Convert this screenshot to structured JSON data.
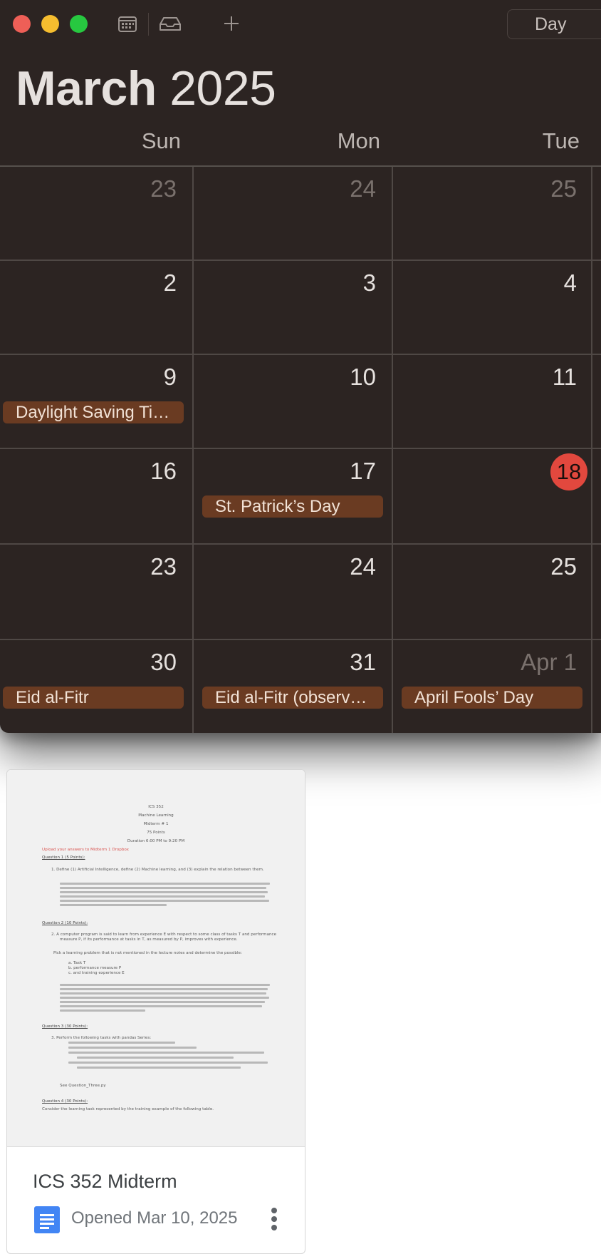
{
  "toolbar": {
    "view_button": "Day",
    "icons": [
      "close-icon",
      "minimize-icon",
      "zoom-icon",
      "calendar-list-icon",
      "inbox-icon",
      "add-icon"
    ]
  },
  "header": {
    "month": "March",
    "year": "2025"
  },
  "weekdays": [
    "Sun",
    "Mon",
    "Tue"
  ],
  "rows": [
    [
      {
        "label": "23",
        "state": "dim"
      },
      {
        "label": "24",
        "state": "dim"
      },
      {
        "label": "25",
        "state": "dim"
      }
    ],
    [
      {
        "label": "2",
        "state": "cur"
      },
      {
        "label": "3",
        "state": "cur"
      },
      {
        "label": "4",
        "state": "cur"
      }
    ],
    [
      {
        "label": "9",
        "state": "cur"
      },
      {
        "label": "10",
        "state": "cur"
      },
      {
        "label": "11",
        "state": "cur"
      }
    ],
    [
      {
        "label": "16",
        "state": "cur"
      },
      {
        "label": "17",
        "state": "cur"
      },
      {
        "label": "18",
        "state": "today"
      }
    ],
    [
      {
        "label": "23",
        "state": "cur"
      },
      {
        "label": "24",
        "state": "cur"
      },
      {
        "label": "25",
        "state": "cur"
      }
    ],
    [
      {
        "label": "30",
        "state": "cur"
      },
      {
        "label": "31",
        "state": "cur"
      },
      {
        "label": "Apr 1",
        "state": "dim"
      }
    ]
  ],
  "events": {
    "dst": "Daylight Saving Ti…",
    "st_patricks": "St. Patrick’s Day",
    "eid": "Eid al-Fitr",
    "eid_observed": "Eid al-Fitr (observ…",
    "april_fools": "April Fools’ Day"
  },
  "colors": {
    "window_bg": "#2c2422",
    "event_bg": "#6a3b22",
    "today_badge": "#e2483e",
    "close": "#ee5f57",
    "minimize": "#f5bd2f",
    "zoom": "#27c840",
    "docs_blue": "#4285f4"
  },
  "document": {
    "title": "ICS 352 Midterm",
    "opened_label": "Opened",
    "opened_date": "Mar 10, 2025",
    "preview": {
      "course": "ICS 352",
      "subject": "Machine Learning",
      "exam": "Midterm # 1",
      "points": "75 Points",
      "duration": "Duration 6:00 PM to 9:20 PM",
      "upload_note": "Upload your answers to Midterm 1 Dropbox",
      "q1": "Question 1 (5 Points):",
      "q1_text": "1.    Define (1) Artificial Intelligence, define (2) Machine learning, and (3) explain the relation between them.",
      "q2": "Question 2 (10 Points):",
      "q2_text": "2.    A computer program is said to learn from experience E with respect to some class of tasks T and performance",
      "q2_text2": "measure P, if its performance at tasks in T, as measured by P, improves with experience.",
      "q2_pick": "Pick a learning problem that is not mentioned in the lecture notes and determine the possible:",
      "q2_a": "a.    Task T",
      "q2_b": "b.    performance measure P",
      "q2_c": "c.    and training experience E",
      "q3": "Question 3 (30 Points):",
      "q3_text": "3.    Perform the following tasks with pandas Series:",
      "see_file": "See Question_Three.py",
      "q4": "Question 4 (30 Points):",
      "q4_text": "Consider the learning task represented by the training example of the following table."
    }
  }
}
